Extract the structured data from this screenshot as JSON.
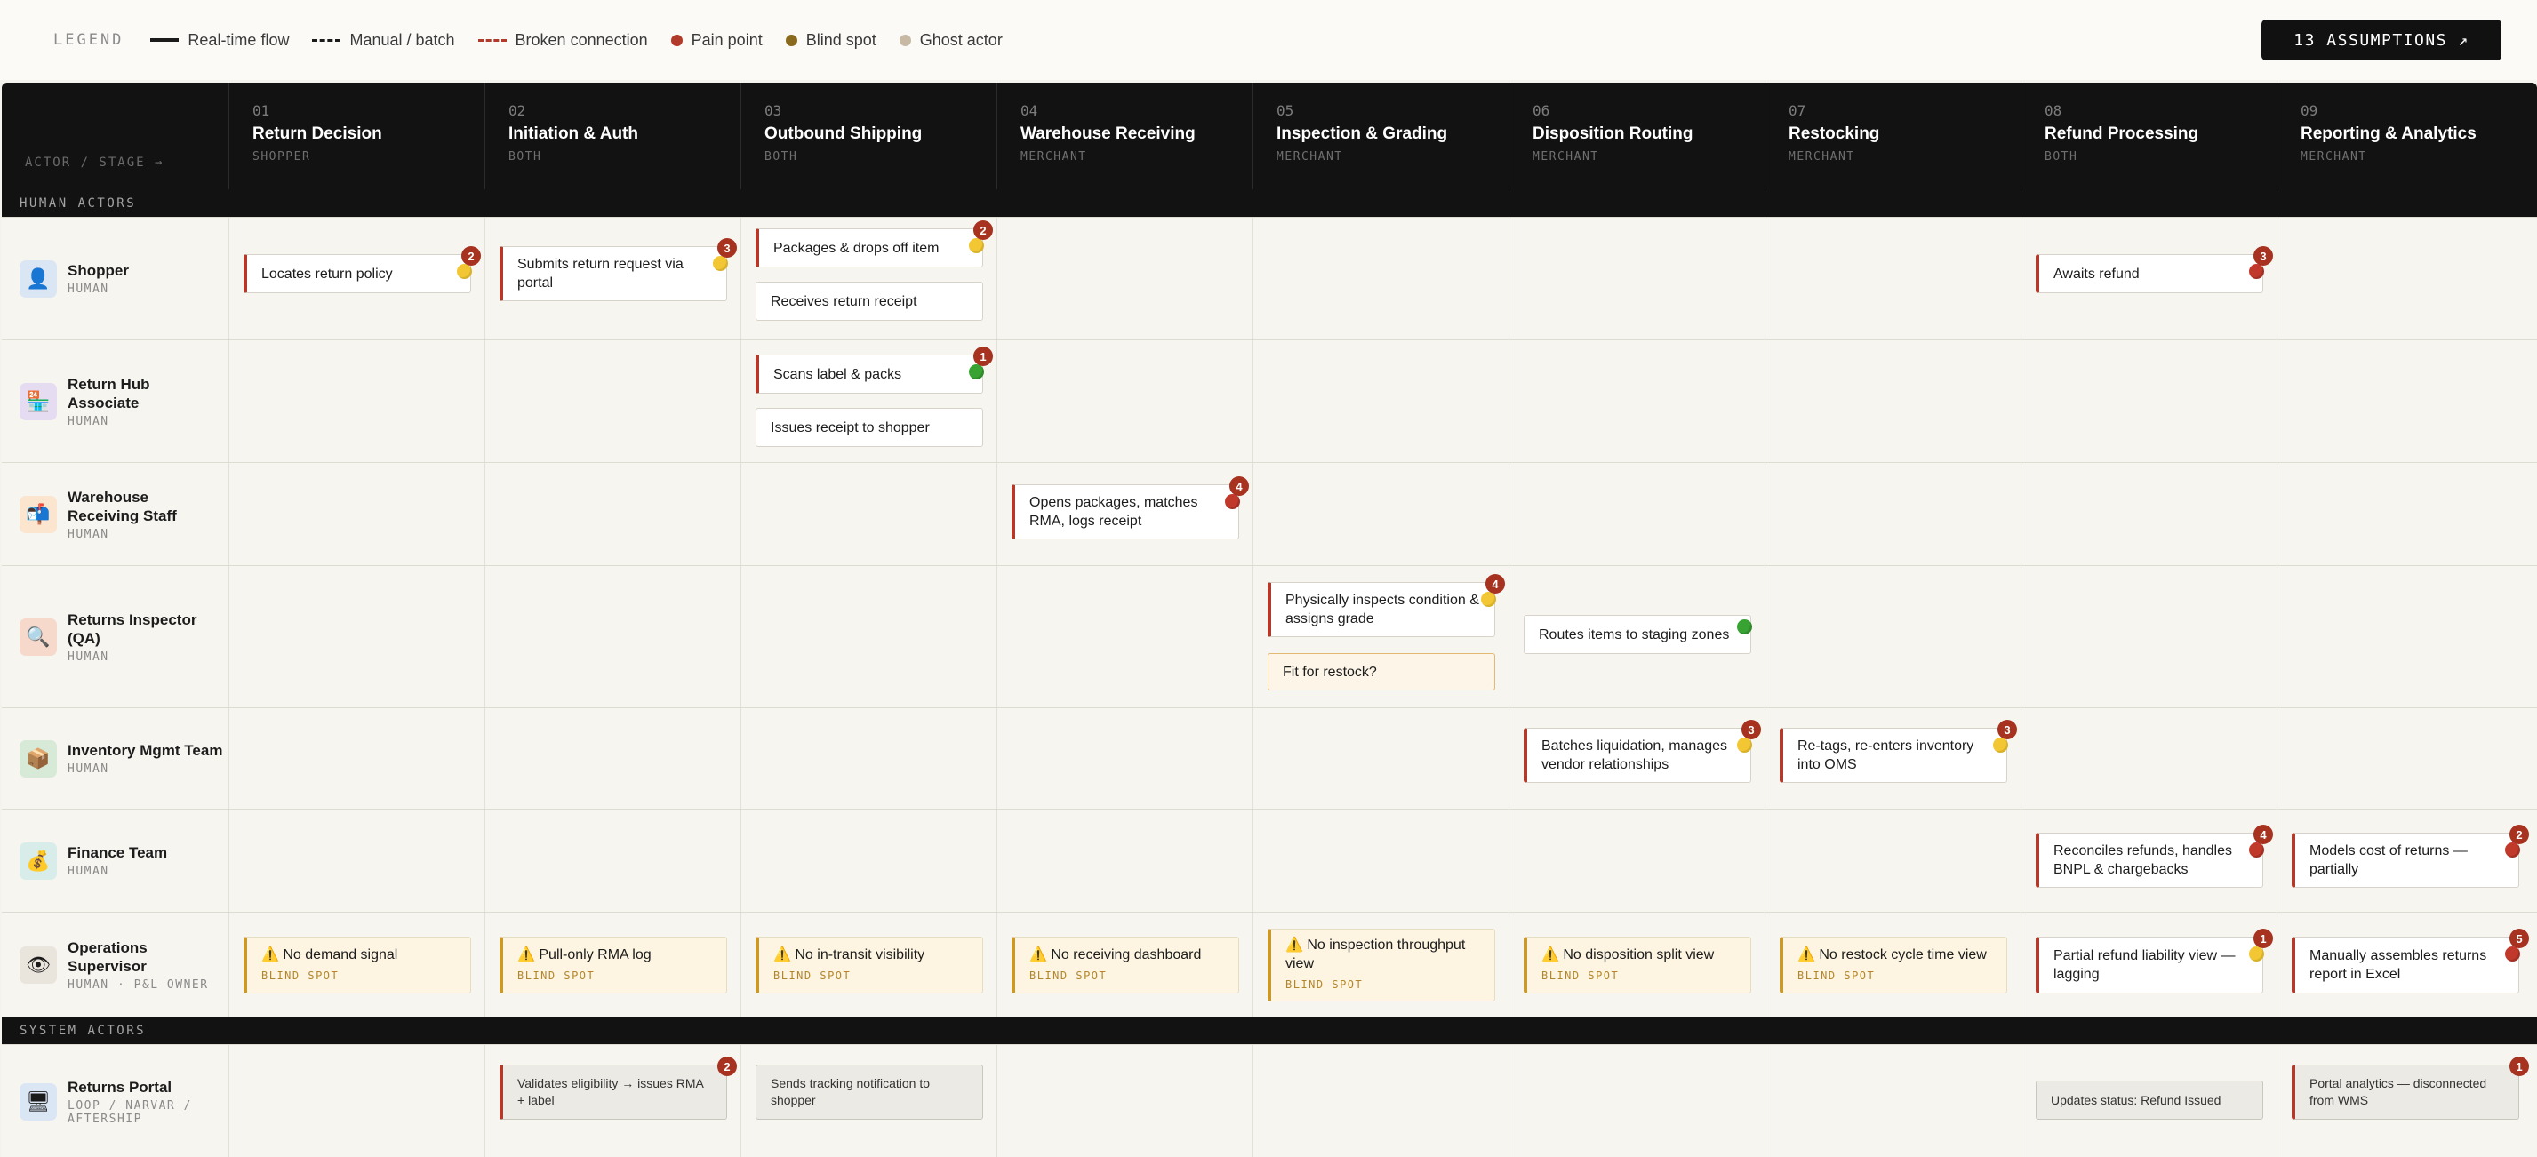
{
  "legend": {
    "title": "LEGEND",
    "items": [
      {
        "label": "Real-time flow",
        "kind": "solid"
      },
      {
        "label": "Manual / batch",
        "kind": "dash"
      },
      {
        "label": "Broken connection",
        "kind": "broken"
      },
      {
        "label": "Pain point",
        "kind": "dot",
        "color": "#b23a2a"
      },
      {
        "label": "Blind spot",
        "kind": "dot",
        "color": "#8a6a1e"
      },
      {
        "label": "Ghost actor",
        "kind": "dot",
        "color": "#c7b9a3"
      }
    ]
  },
  "assumptions_button": "13 ASSUMPTIONS ↗",
  "header": {
    "corner": "ACTOR / STAGE →",
    "stages": [
      {
        "num": "01",
        "title": "Return Decision",
        "owner": "SHOPPER"
      },
      {
        "num": "02",
        "title": "Initiation & Auth",
        "owner": "BOTH"
      },
      {
        "num": "03",
        "title": "Outbound Shipping",
        "owner": "BOTH"
      },
      {
        "num": "04",
        "title": "Warehouse Receiving",
        "owner": "MERCHANT"
      },
      {
        "num": "05",
        "title": "Inspection & Grading",
        "owner": "MERCHANT"
      },
      {
        "num": "06",
        "title": "Disposition Routing",
        "owner": "MERCHANT"
      },
      {
        "num": "07",
        "title": "Restocking",
        "owner": "MERCHANT"
      },
      {
        "num": "08",
        "title": "Refund Processing",
        "owner": "BOTH"
      },
      {
        "num": "09",
        "title": "Reporting & Analytics",
        "owner": "MERCHANT"
      }
    ]
  },
  "sections": {
    "human": "HUMAN ACTORS",
    "system": "SYSTEM ACTORS"
  },
  "rows": [
    {
      "actor": {
        "name": "Shopper",
        "type": "HUMAN",
        "icon": "👤",
        "icon_bg": "#dbe6f5",
        "icon_name": "user-icon"
      },
      "cards": {
        "c0": {
          "text": "Locates return policy",
          "style": "pain",
          "dot": "yellow",
          "badge": "2"
        },
        "c1": {
          "text": "Submits return request via portal",
          "style": "pain",
          "dot": "yellow",
          "badge": "3"
        },
        "c2a": {
          "text": "Packages & drops off item",
          "style": "pain",
          "dot": "yellow",
          "badge": "2"
        },
        "c2b": {
          "text": "Receives return receipt",
          "style": "plain"
        },
        "c7": {
          "text": "Awaits refund",
          "style": "pain",
          "dot": "red",
          "badge": "3"
        }
      }
    },
    {
      "actor": {
        "name": "Return Hub Associate",
        "type": "HUMAN",
        "icon": "🏪",
        "icon_bg": "#e6dcf2",
        "icon_name": "store-icon"
      },
      "cards": {
        "c2a": {
          "text": "Scans label & packs",
          "style": "pain",
          "dot": "green",
          "badge": "1"
        },
        "c2b": {
          "text": "Issues receipt to shopper",
          "style": "plain"
        }
      }
    },
    {
      "actor": {
        "name": "Warehouse Receiving Staff",
        "type": "HUMAN",
        "icon": "📬",
        "icon_bg": "#fbe5cf",
        "icon_name": "mailbox-icon"
      },
      "cards": {
        "c3": {
          "text": "Opens packages, matches RMA, logs receipt",
          "style": "pain",
          "dot": "red",
          "badge": "4"
        }
      }
    },
    {
      "actor": {
        "name": "Returns Inspector (QA)",
        "type": "HUMAN",
        "icon": "🔍",
        "icon_bg": "#f7d9cc",
        "icon_name": "magnifier-icon"
      },
      "cards": {
        "c4a": {
          "text": "Physically inspects condition & assigns grade",
          "style": "pain",
          "dot": "yellow",
          "badge": "4"
        },
        "c4b": {
          "text": "Fit for restock?",
          "style": "question"
        },
        "c5": {
          "text": "Routes items to staging zones",
          "style": "plain",
          "dot": "green"
        }
      }
    },
    {
      "actor": {
        "name": "Inventory Mgmt Team",
        "type": "HUMAN",
        "icon": "📦",
        "icon_bg": "#d6ead7",
        "icon_name": "box-icon"
      },
      "cards": {
        "c5": {
          "text": "Batches liquidation, manages vendor relationships",
          "style": "pain",
          "dot": "yellow",
          "badge": "3"
        },
        "c6": {
          "text": "Re-tags, re-enters inventory into OMS",
          "style": "pain",
          "dot": "yellow",
          "badge": "3"
        }
      }
    },
    {
      "actor": {
        "name": "Finance Team",
        "type": "HUMAN",
        "icon": "💰",
        "icon_bg": "#d8ece9",
        "icon_name": "money-bag-icon"
      },
      "cards": {
        "c7": {
          "text": "Reconciles refunds, handles BNPL & chargebacks",
          "style": "pain",
          "dot": "red",
          "badge": "4"
        },
        "c8": {
          "text": "Models cost of returns — partially",
          "style": "pain",
          "dot": "red",
          "badge": "2"
        }
      }
    },
    {
      "actor": {
        "name": "Operations Supervisor",
        "type": "HUMAN · P&L OWNER",
        "icon": "👁",
        "icon_bg": "#e9e4dc",
        "icon_name": "eye-icon"
      },
      "cards": {
        "c0": {
          "text": "⚠️ No demand signal",
          "style": "blind",
          "tag": "BLIND SPOT"
        },
        "c1": {
          "text": "⚠️ Pull-only RMA log",
          "style": "blind",
          "tag": "BLIND SPOT"
        },
        "c2": {
          "text": "⚠️ No in-transit visibility",
          "style": "blind",
          "tag": "BLIND SPOT"
        },
        "c3": {
          "text": "⚠️ No receiving dashboard",
          "style": "blind",
          "tag": "BLIND SPOT"
        },
        "c4": {
          "text": "⚠️ No inspection throughput view",
          "style": "blind",
          "tag": "BLIND SPOT"
        },
        "c5": {
          "text": "⚠️ No disposition split view",
          "style": "blind",
          "tag": "BLIND SPOT"
        },
        "c6": {
          "text": "⚠️ No restock cycle time view",
          "style": "blind",
          "tag": "BLIND SPOT"
        },
        "c7": {
          "text": "Partial refund liability view — lagging",
          "style": "pain",
          "dot": "yellow",
          "badge": "1"
        },
        "c8": {
          "text": "Manually assembles returns report in Excel",
          "style": "pain",
          "dot": "red",
          "badge": "5"
        }
      }
    },
    {
      "actor": {
        "name": "Returns Portal",
        "type": "LOOP / NARVAR / AFTERSHIP",
        "icon": "🖥",
        "icon_bg": "#dbe6f5",
        "icon_name": "monitor-icon"
      },
      "cards": {
        "c1": {
          "text": "Validates eligibility → issues RMA + label",
          "style": "sys pain",
          "badge": "2"
        },
        "c2": {
          "text": "Sends tracking notification to shopper",
          "style": "sys"
        },
        "c7": {
          "text": "Updates status: Refund Issued",
          "style": "sys"
        },
        "c8": {
          "text": "Portal analytics — disconnected from WMS",
          "style": "sys pain",
          "badge": "1"
        }
      }
    }
  ]
}
